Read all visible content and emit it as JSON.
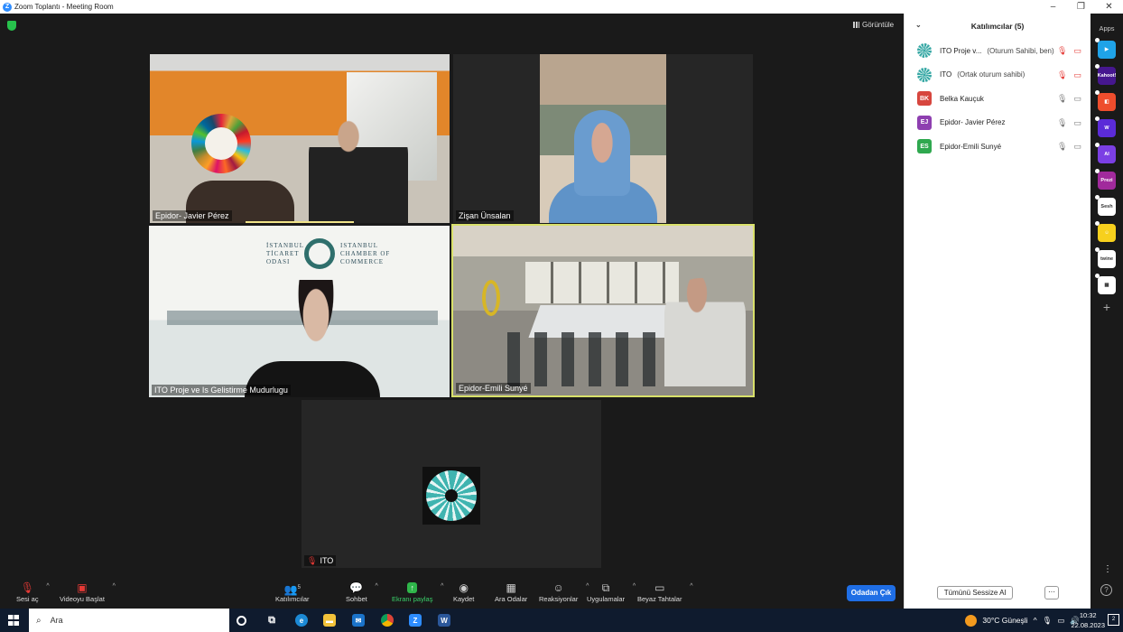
{
  "window": {
    "title": "Zoom Toplantı - Meeting Room",
    "logo_letter": "Z",
    "min": "–",
    "restore": "❐",
    "close": "✕"
  },
  "stage": {
    "view_label": "Görüntüle"
  },
  "tiles": [
    {
      "name": "Epidor- Javier Pérez"
    },
    {
      "name": "Zişan Ünsalan"
    },
    {
      "name": "ITO Proje ve Is Gelistirme Mudurlugu"
    },
    {
      "name": "Epidor-Emili Sunyé"
    },
    {
      "name": "ITO"
    }
  ],
  "ito_banner": {
    "left": "İSTANBUL TİCARET ODASI",
    "right": "ISTANBUL CHAMBER OF COMMERCE"
  },
  "toolbar": {
    "mute": "Sesi aç",
    "video": "Videoyu Başlat",
    "participants": "Katılımcılar",
    "participants_count": "5",
    "chat": "Sohbet",
    "share": "Ekranı paylaş",
    "record": "Kaydet",
    "breakout": "Ara Odalar",
    "reactions": "Reaksiyonlar",
    "apps": "Uygulamalar",
    "whiteboard": "Beyaz Tahtalar",
    "leave": "Odadan Çık"
  },
  "panel": {
    "title": "Katılımcılar (5)",
    "participants": [
      {
        "initials": "",
        "name": "ITO Proje v...",
        "role": "(Oturum Sahibi, ben)",
        "color": "#3aa9a6",
        "muted": true,
        "video_off": true
      },
      {
        "initials": "",
        "name": "ITO",
        "role": "(Ortak oturum sahibi)",
        "color": "#3aa9a6",
        "muted": true,
        "video_off": true
      },
      {
        "initials": "BK",
        "name": "Belka Kauçuk",
        "role": "",
        "color": "#d7463e",
        "muted": false,
        "video_off": false
      },
      {
        "initials": "EJ",
        "name": "Epidor- Javier Pérez",
        "role": "",
        "color": "#8e3fb0",
        "muted": false,
        "video_off": false
      },
      {
        "initials": "ES",
        "name": "Epidor-Emili Sunyé",
        "role": "",
        "color": "#2fa84f",
        "muted": false,
        "video_off": false
      }
    ],
    "mute_all": "Tümünü Sessize Al",
    "more": "···"
  },
  "apps_bar": {
    "label": "Apps",
    "apps": [
      {
        "name": "play-app",
        "text": "▶",
        "color": "#1fa3e8"
      },
      {
        "name": "kahoot-app",
        "text": "Kahoot!",
        "color": "#46178f"
      },
      {
        "name": "orange-app",
        "text": "◧",
        "color": "#ee4d2d"
      },
      {
        "name": "w-app",
        "text": "W",
        "color": "#5b2bd8"
      },
      {
        "name": "ai-app",
        "text": "AI",
        "color": "#7b3fe4"
      },
      {
        "name": "prezi-app",
        "text": "Prezi",
        "color": "#a12a9c"
      },
      {
        "name": "sesh-app",
        "text": "Sesh",
        "color": "#ffffff"
      },
      {
        "name": "smile-app",
        "text": "☺",
        "color": "#f7d01d"
      },
      {
        "name": "twine-app",
        "text": "twine",
        "color": "#ffffff"
      },
      {
        "name": "blocks-app",
        "text": "▦",
        "color": "#ffffff"
      }
    ]
  },
  "taskbar": {
    "search": "Ara",
    "weather": "30°C  Güneşli",
    "time": "10:32",
    "date": "22.08.2023",
    "notif": "2"
  }
}
